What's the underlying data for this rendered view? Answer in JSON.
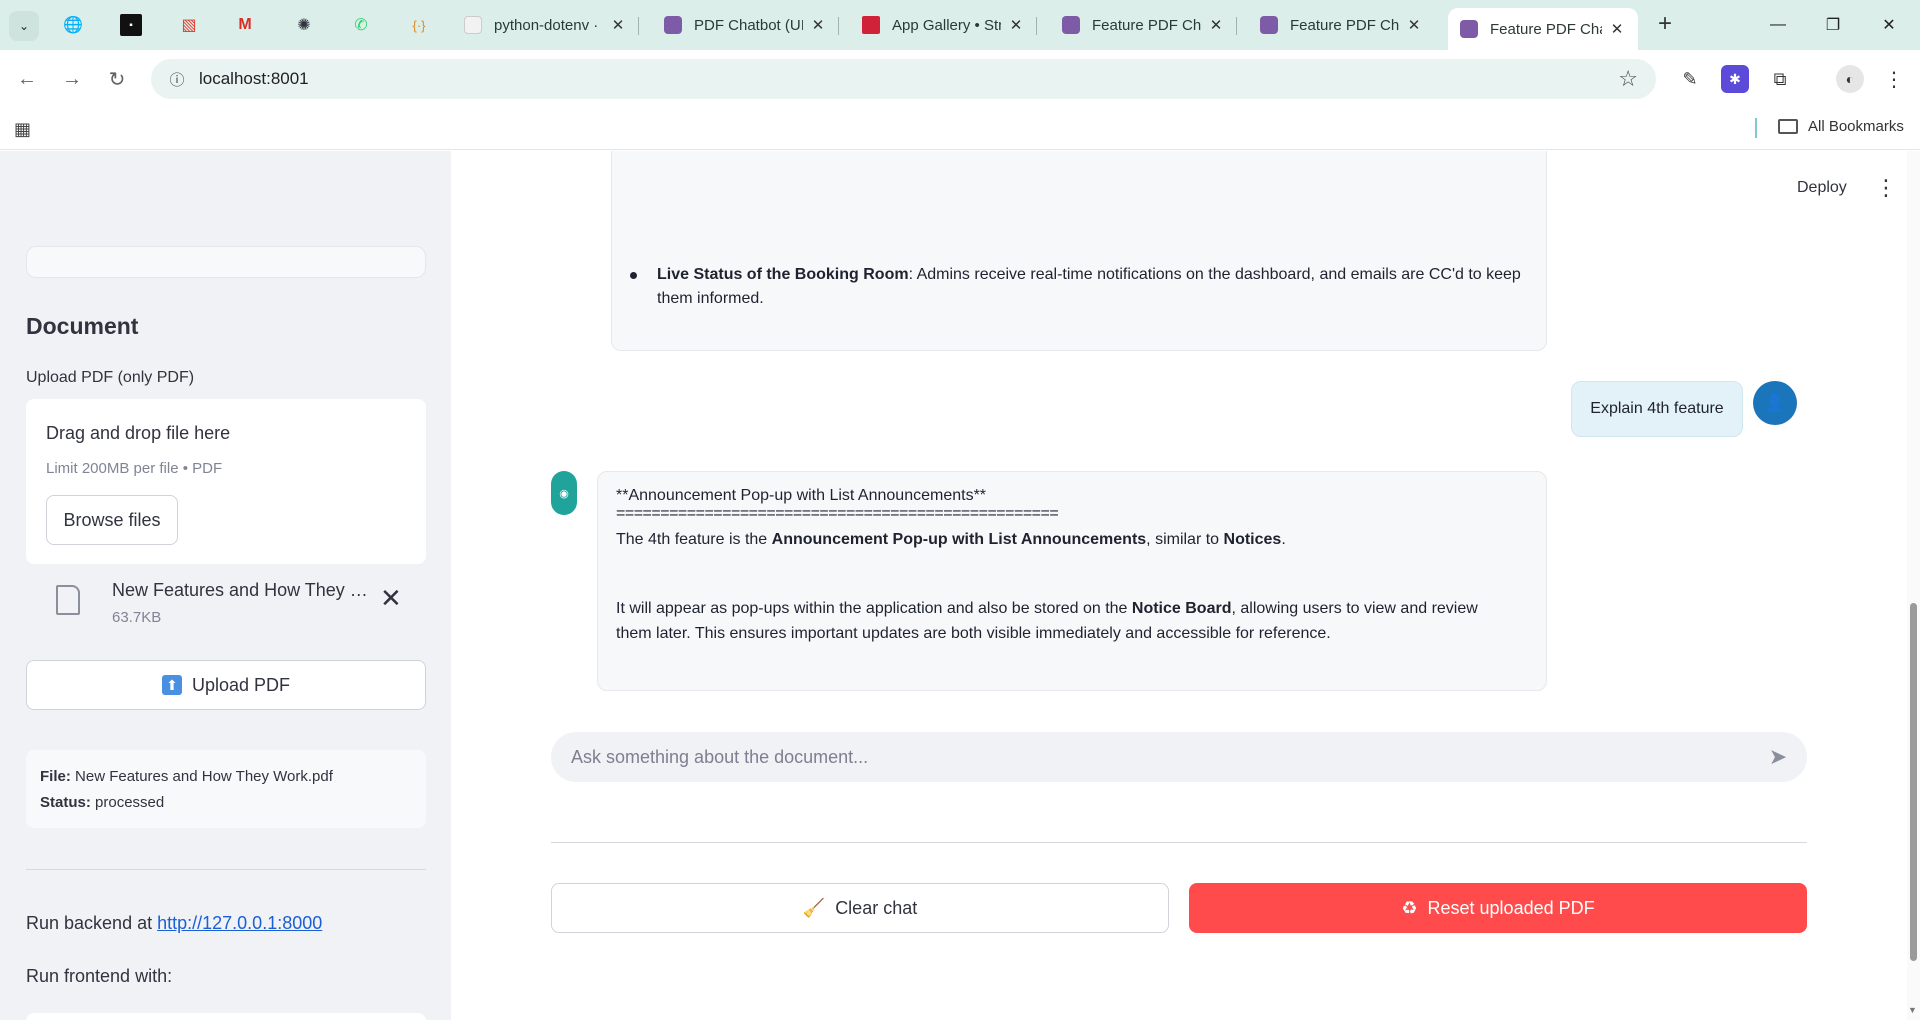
{
  "browser": {
    "tabs": [
      {
        "title": "python-dotenv ·",
        "color": "#f2f2f2"
      },
      {
        "title": "PDF Chatbot (UI)",
        "color": "#7d5ba6"
      },
      {
        "title": "App Gallery • Str",
        "color": "#d0233a"
      },
      {
        "title": "Feature PDF Cha",
        "color": "#7d5ba6"
      },
      {
        "title": "Feature PDF Cha",
        "color": "#7d5ba6"
      },
      {
        "title": "Feature PDF Cha",
        "color": "#7d5ba6",
        "active": true
      }
    ],
    "close_glyph": "✕",
    "url": "localhost:8001",
    "all_bookmarks": "All Bookmarks"
  },
  "sidebar": {
    "section_title": "Document",
    "upload_label": "Upload PDF (only PDF)",
    "dropzone_title": "Drag and drop file here",
    "dropzone_limit": "Limit 200MB per file • PDF",
    "browse_label": "Browse files",
    "file_name": "New Features and How They Work.pdf",
    "file_size": "63.7KB",
    "upload_button": "Upload PDF",
    "info_file_label": "File:",
    "info_file_value": "New Features and How They Work.pdf",
    "info_status_label": "Status:",
    "info_status_value": "processed",
    "run_backend_prefix": "Run backend at",
    "run_backend_link": "http://127.0.0.1:8000",
    "run_frontend": "Run frontend with:"
  },
  "header": {
    "deploy": "Deploy"
  },
  "chat": {
    "prev_bullet_bold": "Live Status of the Booking Room",
    "prev_bullet_rest_1": ": Admins receive real-time notifications on the dashboard, and emails are CC'd to keep",
    "prev_bullet_rest_2": "them informed.",
    "user_message": "Explain 4th feature",
    "bot_heading": "**Announcement Pop-up with List Announcements**",
    "bot_rule": "==================================================",
    "bot_p1_a": "The 4th feature is the ",
    "bot_p1_b": "Announcement Pop-up with List Announcements",
    "bot_p1_c": ", similar to ",
    "bot_p1_d": "Notices",
    "bot_p1_e": ".",
    "bot_p2_a": "It will appear as pop-ups within the application and also be stored on the ",
    "bot_p2_b": "Notice Board",
    "bot_p2_c": ", allowing users to view and review",
    "bot_p2_d": "them later. This ensures important updates are both visible immediately and accessible for reference.",
    "input_placeholder": "Ask something about the document..."
  },
  "actions": {
    "clear_chat": "Clear chat",
    "reset_pdf": "Reset uploaded PDF"
  },
  "colors": {
    "primary": "#ff4b4b",
    "sidebar_bg": "#f0f2f6",
    "link": "#1a5fd6"
  }
}
